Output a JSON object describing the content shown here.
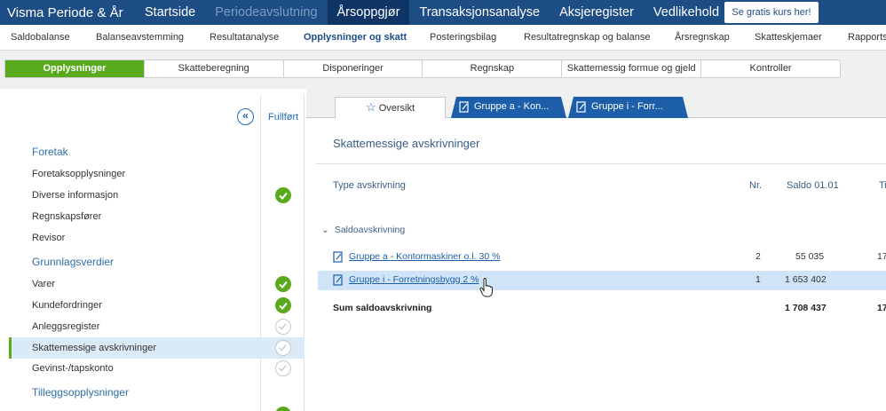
{
  "topnav": {
    "brand": "Visma Periode & År",
    "tabs": [
      {
        "label": "Startside"
      },
      {
        "label": "Periodeavslutning"
      },
      {
        "label": "Årsoppgjør"
      },
      {
        "label": "Transaksjonsanalyse"
      },
      {
        "label": "Aksjeregister"
      },
      {
        "label": "Vedlikehold"
      }
    ],
    "cta": "Se gratis kurs her!"
  },
  "subnav": {
    "items": [
      {
        "label": "Saldobalanse"
      },
      {
        "label": "Balanseavstemming"
      },
      {
        "label": "Resultatanalyse"
      },
      {
        "label": "Opplysninger og skatt"
      },
      {
        "label": "Posteringsbilag"
      },
      {
        "label": "Resultatregnskap og balanse"
      },
      {
        "label": "Årsregnskap"
      },
      {
        "label": "Skatteskjemaer"
      },
      {
        "label": "Rapports"
      }
    ]
  },
  "section_tabs": [
    {
      "label": "Opplysninger"
    },
    {
      "label": "Skatteberegning"
    },
    {
      "label": "Disponeringer"
    },
    {
      "label": "Regnskap"
    },
    {
      "label": "Skattemessig formue og gjeld"
    },
    {
      "label": "Kontroller"
    }
  ],
  "left_panel": {
    "completed_header": "Fullført",
    "collapse_icon": "double-chevron-left-icon",
    "rows": [
      {
        "label": "Foretak",
        "type": "group"
      },
      {
        "label": "Foretaksopplysninger",
        "status": "none"
      },
      {
        "label": "Diverse informasjon",
        "status": "done"
      },
      {
        "label": "Regnskapsfører",
        "status": "none"
      },
      {
        "label": "Revisor",
        "status": "none"
      },
      {
        "label": "Grunnlagsverdier",
        "type": "group"
      },
      {
        "label": "Varer",
        "status": "done"
      },
      {
        "label": "Kundefordringer",
        "status": "done"
      },
      {
        "label": "Anleggsregister",
        "status": "pending"
      },
      {
        "label": "Skattemessige avskrivninger",
        "status": "pending",
        "selected": true
      },
      {
        "label": "Gevinst-/tapskonto",
        "status": "pending"
      },
      {
        "label": "Tilleggsopplysninger",
        "type": "group",
        "status": "done"
      }
    ]
  },
  "right_panel": {
    "tabs": [
      {
        "label": "Oversikt",
        "icon": "star-icon"
      },
      {
        "label": "Gruppe a - Kon...",
        "icon": "edit-document-icon"
      },
      {
        "label": "Gruppe i - Forr...",
        "icon": "edit-document-icon"
      }
    ],
    "title": "Skattemessige avskrivninger",
    "columns": {
      "type": "Type avskrivning",
      "nr": "Nr.",
      "saldo": "Saldo 01.01",
      "next": "Ti"
    },
    "group_label": "Saldoavskrivning",
    "rows": [
      {
        "name": "Gruppe a - Kontormaskiner o.l. 30 %",
        "nr": "2",
        "saldo": "55 035",
        "next": "17"
      },
      {
        "name": "Gruppe i - Forretningsbygg 2 %",
        "nr": "1",
        "saldo": "1 653 402",
        "next": ""
      }
    ],
    "sum": {
      "label": "Sum saldoavskrivning",
      "saldo": "1 708 437",
      "next": "17"
    }
  },
  "colors": {
    "nav_blue": "#1c4d84",
    "active_green": "#5aaa1e",
    "highlight_blue": "#cfe5f7",
    "tab_blue": "#1c5fa8"
  }
}
